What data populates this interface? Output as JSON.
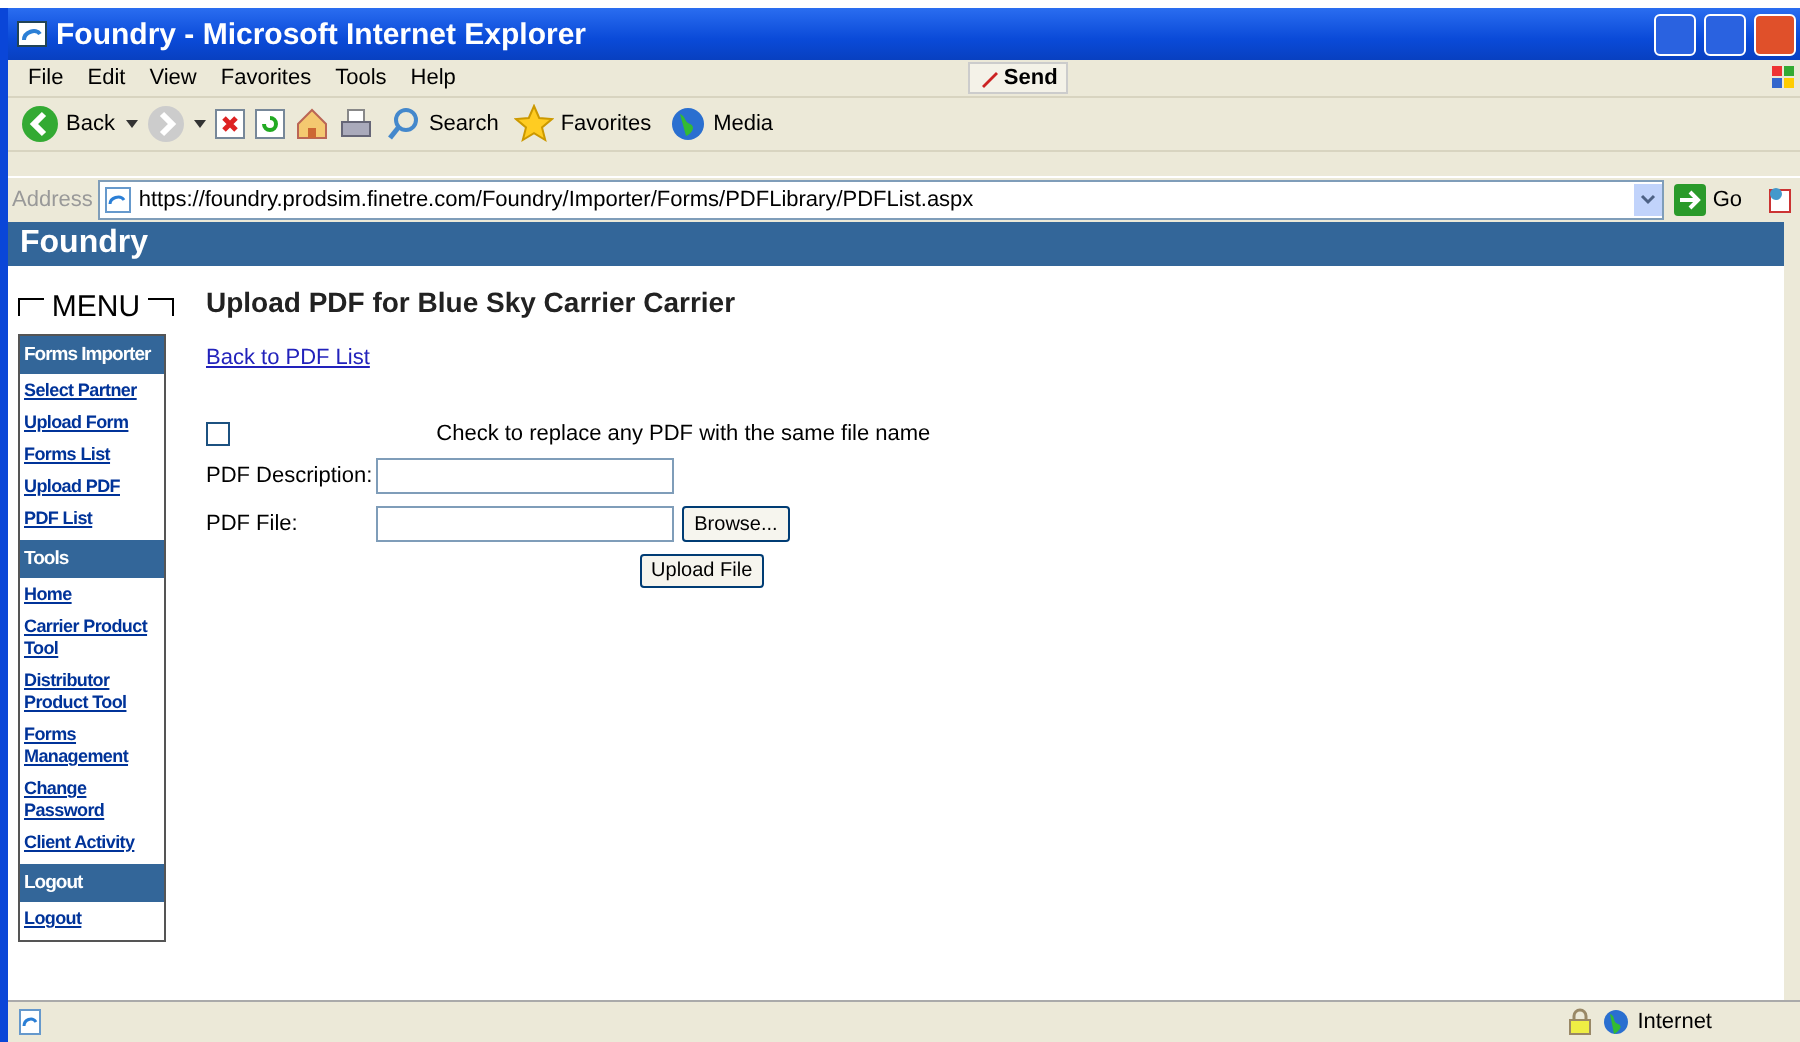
{
  "window": {
    "title": "Foundry - Microsoft Internet Explorer"
  },
  "menu_bar": {
    "items": [
      "File",
      "Edit",
      "View",
      "Favorites",
      "Tools",
      "Help"
    ],
    "send": "Send"
  },
  "toolbar": {
    "back": "Back",
    "search": "Search",
    "favorites": "Favorites",
    "media": "Media"
  },
  "address_bar": {
    "label": "Address",
    "url": "https://foundry.prodsim.finetre.com/Foundry/Importer/Forms/PDFLibrary/PDFList.aspx",
    "go": "Go"
  },
  "site_header": {
    "title": "Foundry"
  },
  "sidebar": {
    "menu_title": "MENU",
    "items": [
      {
        "kind": "header",
        "label": "Forms Importer"
      },
      {
        "kind": "link",
        "label": "Select Partner"
      },
      {
        "kind": "link",
        "label": "Upload Form"
      },
      {
        "kind": "link",
        "label": "Forms List"
      },
      {
        "kind": "link",
        "label": "Upload PDF"
      },
      {
        "kind": "link",
        "label": "PDF List"
      },
      {
        "kind": "header",
        "label": "Tools"
      },
      {
        "kind": "link",
        "label": "Home"
      },
      {
        "kind": "link",
        "label": "Carrier Product Tool"
      },
      {
        "kind": "link",
        "label": "Distributor Product Tool"
      },
      {
        "kind": "link",
        "label": "Forms Management"
      },
      {
        "kind": "link",
        "label": "Change Password"
      },
      {
        "kind": "link",
        "label": "Client Activity"
      },
      {
        "kind": "header",
        "label": "Logout"
      },
      {
        "kind": "link",
        "label": "Logout"
      }
    ]
  },
  "main": {
    "heading": "Upload PDF for Blue Sky Carrier Carrier",
    "back_link": "Back to PDF List",
    "replace_checkbox": {
      "label": "Check to replace any PDF with the same file name",
      "checked": false
    },
    "description_label": "PDF Description:",
    "file_label": "PDF File:",
    "browse": "Browse...",
    "upload": "Upload File"
  },
  "status_bar": {
    "zone": "Internet"
  }
}
